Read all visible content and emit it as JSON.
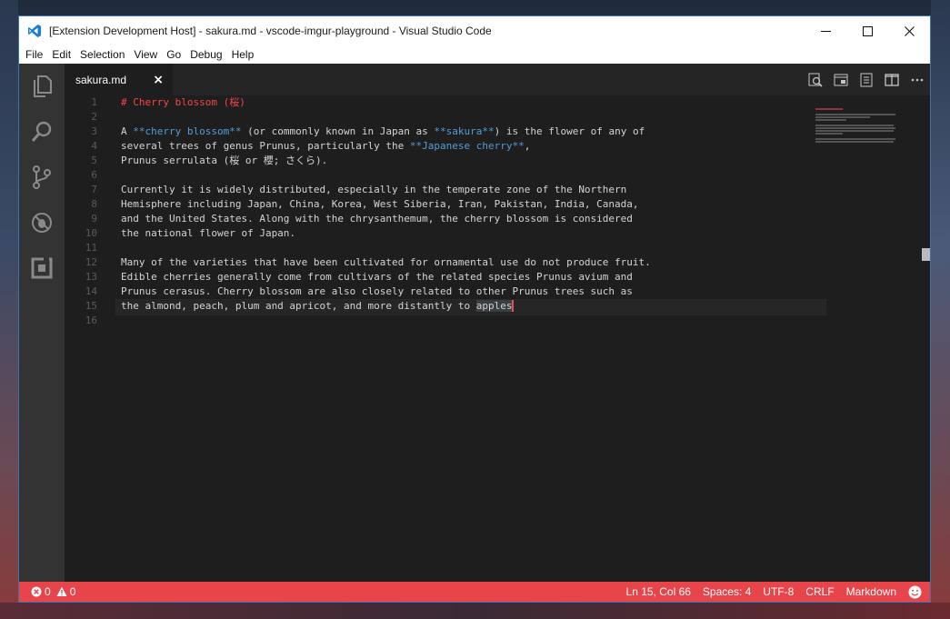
{
  "window": {
    "title": "[Extension Development Host] - sakura.md - vscode-imgur-playground - Visual Studio Code"
  },
  "menu": [
    "File",
    "Edit",
    "Selection",
    "View",
    "Go",
    "Debug",
    "Help"
  ],
  "activity_bar": [
    "explorer-icon",
    "search-icon",
    "source-control-icon",
    "debug-icon",
    "extensions-icon"
  ],
  "tab": {
    "label": "sakura.md",
    "close": "×"
  },
  "tab_actions": [
    "open-preview-icon",
    "open-changes-icon",
    "show-preview-icon",
    "split-editor-icon",
    "more-icon"
  ],
  "editor": {
    "lines": [
      {
        "n": "1",
        "segments": [
          {
            "t": "# Cherry blossom (桜)",
            "s": "heading"
          }
        ]
      },
      {
        "n": "2",
        "segments": [
          {
            "t": "",
            "s": ""
          }
        ]
      },
      {
        "n": "3",
        "segments": [
          {
            "t": "A ",
            "s": ""
          },
          {
            "t": "**cherry blossom**",
            "s": "bold"
          },
          {
            "t": " (or commonly known in Japan as ",
            "s": ""
          },
          {
            "t": "**sakura**",
            "s": "bold"
          },
          {
            "t": ") is the flower of any of",
            "s": ""
          }
        ]
      },
      {
        "n": "4",
        "segments": [
          {
            "t": "several trees of genus Prunus, particularly the ",
            "s": ""
          },
          {
            "t": "**Japanese cherry**",
            "s": "bold"
          },
          {
            "t": ",",
            "s": ""
          }
        ]
      },
      {
        "n": "5",
        "segments": [
          {
            "t": "Prunus serrulata (桜 or 櫻; さくら).",
            "s": ""
          }
        ]
      },
      {
        "n": "6",
        "segments": [
          {
            "t": "",
            "s": ""
          }
        ]
      },
      {
        "n": "7",
        "segments": [
          {
            "t": "Currently it is widely distributed, especially in the temperate zone of the Northern",
            "s": ""
          }
        ]
      },
      {
        "n": "8",
        "segments": [
          {
            "t": "Hemisphere including Japan, China, Korea, West Siberia, Iran, Pakistan, India, Canada,",
            "s": ""
          }
        ]
      },
      {
        "n": "9",
        "segments": [
          {
            "t": "and the United States. Along with the chrysanthemum, the cherry blossom is considered",
            "s": ""
          }
        ]
      },
      {
        "n": "10",
        "segments": [
          {
            "t": "the national flower of Japan.",
            "s": ""
          }
        ]
      },
      {
        "n": "11",
        "segments": [
          {
            "t": "",
            "s": ""
          }
        ]
      },
      {
        "n": "12",
        "segments": [
          {
            "t": "Many of the varieties that have been cultivated for ornamental use do not produce fruit.",
            "s": ""
          }
        ]
      },
      {
        "n": "13",
        "segments": [
          {
            "t": "Edible cherries generally come from cultivars of the related species Prunus avium and",
            "s": ""
          }
        ]
      },
      {
        "n": "14",
        "segments": [
          {
            "t": "Prunus cerasus. Cherry blossom are also closely related to other Prunus trees such as",
            "s": ""
          }
        ]
      },
      {
        "n": "15",
        "segments": [
          {
            "t": "the almond, peach, plum and apricot, and more distantly to ",
            "s": ""
          },
          {
            "t": "apples",
            "s": "sel"
          }
        ]
      },
      {
        "n": "16",
        "segments": [
          {
            "t": "",
            "s": ""
          }
        ]
      }
    ]
  },
  "status": {
    "errors": "0",
    "warnings": "0",
    "position": "Ln 15, Col 66",
    "spaces": "Spaces: 4",
    "encoding": "UTF-8",
    "eol": "CRLF",
    "language": "Markdown",
    "feedback_icon": "smiley-icon"
  },
  "colors": {
    "status_bar": "#e8454a",
    "heading": "#f44747",
    "bold": "#569cd6",
    "editor_bg": "#1e1e1e"
  }
}
